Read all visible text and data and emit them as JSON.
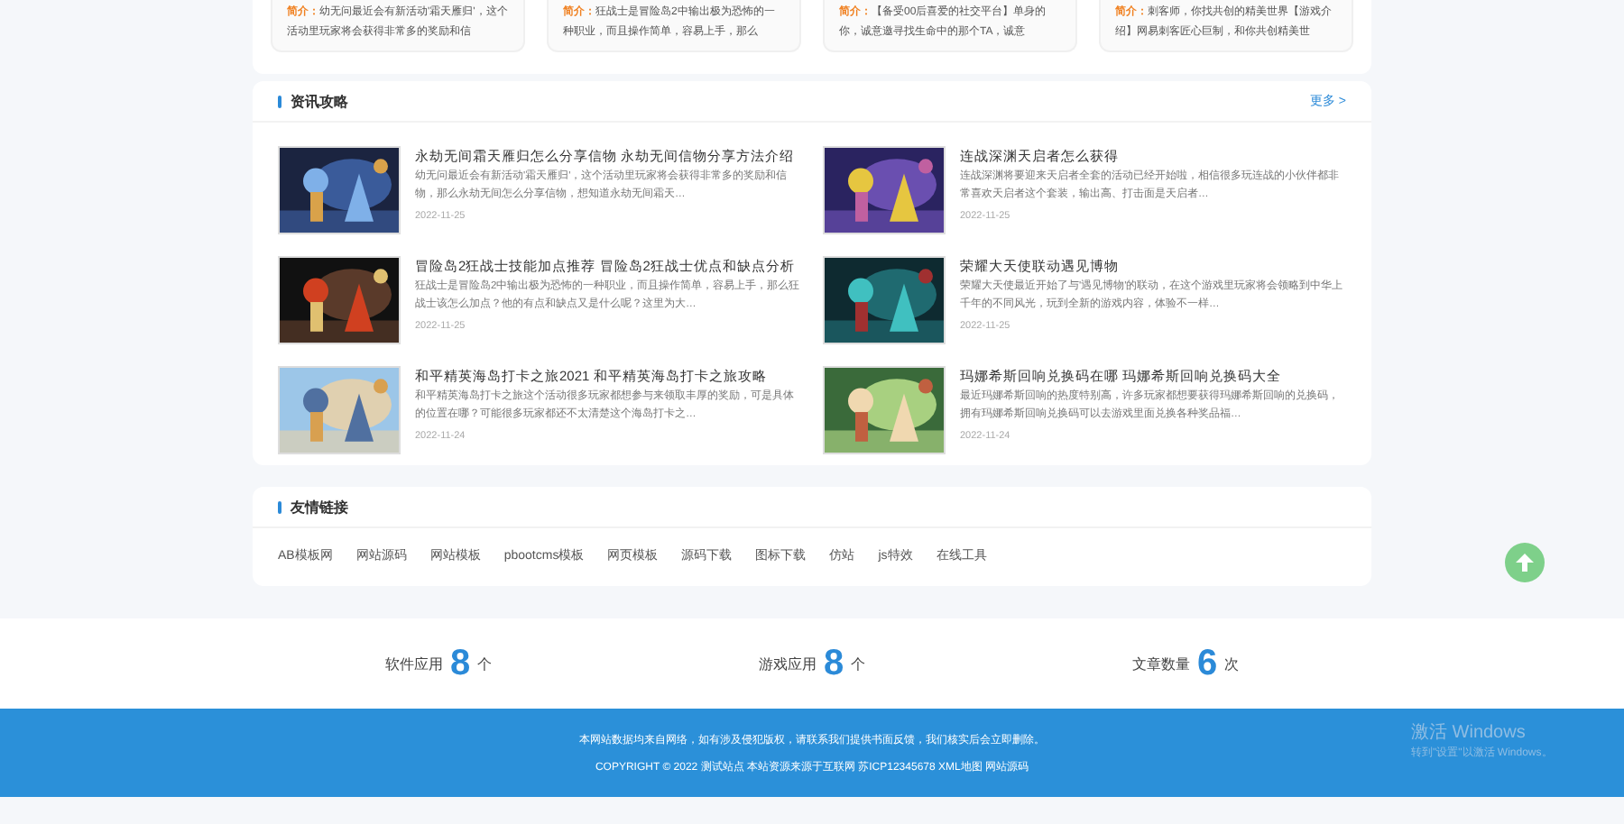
{
  "intro_cards": [
    {
      "label": "简介：",
      "text": "幼无问最近会有新活动'霜天雁归'，这个活动里玩家将会获得非常多的奖励和信"
    },
    {
      "label": "简介：",
      "text": "狂战士是冒险岛2中输出极为恐怖的一种职业，而且操作简单，容易上手，那么"
    },
    {
      "label": "简介：",
      "text": "【备受00后喜爱的社交平台】单身的你，诚意邀寻找生命中的那个TA，诚意"
    },
    {
      "label": "简介：",
      "text": "刺客师，你找共创的精美世界【游戏介绍】网易刺客匠心巨制，和你共创精美世"
    }
  ],
  "news": {
    "title": "资讯攻略",
    "more": "更多 >",
    "articles": [
      {
        "title": "永劫无间霜天雁归怎么分享信物 永劫无间信物分享方法介绍",
        "summary": "幼无问最近会有新活动'霜天雁归'，这个活动里玩家将会获得非常多的奖励和信物，那么永劫无间怎么分享信物，想知道永劫无间霜天…",
        "date": "2022-11-25"
      },
      {
        "title": "连战深渊天启者怎么获得",
        "summary": "连战深渊将要迎来天启者全套的活动已经开始啦，相信很多玩连战的小伙伴都非常喜欢天启者这个套装，输出高、打击面是天启者…",
        "date": "2022-11-25"
      },
      {
        "title": "冒险岛2狂战士技能加点推荐 冒险岛2狂战士优点和缺点分析",
        "summary": "狂战士是冒险岛2中输出极为恐怖的一种职业，而且操作简单，容易上手，那么狂战士该怎么加点？他的有点和缺点又是什么呢？这里为大…",
        "date": "2022-11-25"
      },
      {
        "title": "荣耀大天使联动遇见博物",
        "summary": "荣耀大天使最近开始了与'遇见博物'的联动，在这个游戏里玩家将会领略到中华上千年的不同风光，玩到全新的游戏内容，体验不一样…",
        "date": "2022-11-25"
      },
      {
        "title": "和平精英海岛打卡之旅2021 和平精英海岛打卡之旅攻略",
        "summary": "和平精英海岛打卡之旅这个活动很多玩家都想参与来领取丰厚的奖励，可是具体的位置在哪？可能很多玩家都还不太清楚这个海岛打卡之…",
        "date": "2022-11-24"
      },
      {
        "title": "玛娜希斯回响兑换码在哪 玛娜希斯回响兑换码大全",
        "summary": "最近玛娜希斯回响的热度特别高，许多玩家都想要获得玛娜希斯回响的兑换码，拥有玛娜希斯回响兑换码可以去游戏里面兑换各种奖品福…",
        "date": "2022-11-24"
      }
    ]
  },
  "links": {
    "title": "友情链接",
    "items": [
      "AB模板网",
      "网站源码",
      "网站模板",
      "pbootcms模板",
      "网页模板",
      "源码下载",
      "图标下载",
      "仿站",
      "js特效",
      "在线工具"
    ]
  },
  "stats": [
    {
      "label": "软件应用",
      "value": "8",
      "unit": "个"
    },
    {
      "label": "游戏应用",
      "value": "8",
      "unit": "个"
    },
    {
      "label": "文章数量",
      "value": "6",
      "unit": "次"
    }
  ],
  "footer": {
    "notice": "本网站数据均来自网络，如有涉及侵犯版权，请联系我们提供书面反馈，我们核实后会立即删除。",
    "copyright": "COPYRIGHT © 2022 测试站点 本站资源来源于互联网 苏ICP12345678 XML地图 网站源码"
  },
  "os_notice": {
    "title": "激活 Windows",
    "hint": "转到\"设置\"以激活 Windows。"
  }
}
